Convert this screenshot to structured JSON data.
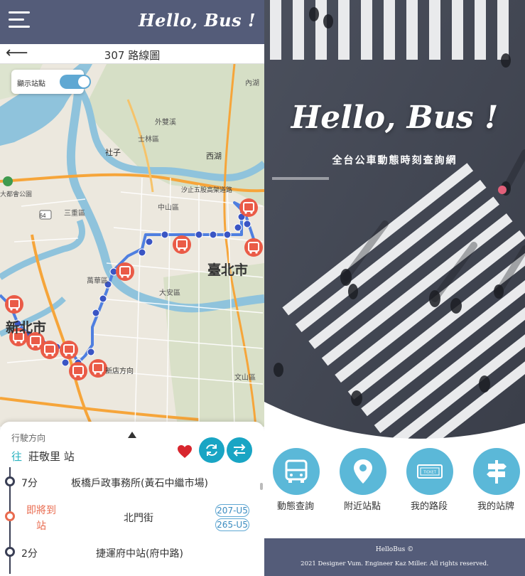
{
  "app": {
    "brand": "Hello, Bus !"
  },
  "route_page": {
    "title": "307 路線圖",
    "map": {
      "toggle_label": "顯示站點",
      "toggle_on": true,
      "labels": {
        "taipei_city": "臺北市",
        "new_taipei_partial": "新北市",
        "shilin": "士林區",
        "shezi": "社子",
        "xihu": "西湖",
        "zhongshan": "中山區",
        "daan": "大安區",
        "wenshan": "文山區",
        "sanchong": "三重區",
        "wanhua": "萬華區",
        "xindian_dir": "新店方向",
        "waishuang": "外雙溪",
        "neihu": "內湖",
        "park": "大都會公園",
        "xizhi_overpass": "汐止五股高架道路",
        "hwy64": "64"
      }
    },
    "sheet": {
      "direction_label": "行駛方向",
      "toward_prefix": "往",
      "toward_stop": "莊敬里 站",
      "favorited": true,
      "stops": [
        {
          "eta": "7分",
          "name": "板橋戶政事務所(黃石中繼市場)",
          "status": "normal"
        },
        {
          "eta_line1": "即將到",
          "eta_line2": "站",
          "name": "北門街",
          "status": "arriving",
          "routes": [
            "207-U5",
            "265-U5"
          ]
        },
        {
          "eta": "2分",
          "name": "捷運府中站(府中路)",
          "status": "normal"
        }
      ]
    }
  },
  "home_page": {
    "hero_title": "Hello, Bus !",
    "hero_subtitle": "全台公車動態時刻查詢網",
    "features": [
      {
        "label": "動態查詢",
        "icon": "bus-icon"
      },
      {
        "label": "附近站點",
        "icon": "map-pin-icon"
      },
      {
        "label": "我的路段",
        "icon": "ticket-icon"
      },
      {
        "label": "我的站牌",
        "icon": "signpost-icon"
      }
    ],
    "footer_brand": "HelloBus ©",
    "footer_credit": "2021 Designer Vum. Engineer Kaz Miller. All rights reserved."
  },
  "colors": {
    "header": "#545c79",
    "accent": "#19a5c4",
    "feature_circle": "#5bb8d8",
    "arriving": "#e96b4f",
    "route_line": "#4f7fe0",
    "bus_marker": "#ea5b47"
  }
}
